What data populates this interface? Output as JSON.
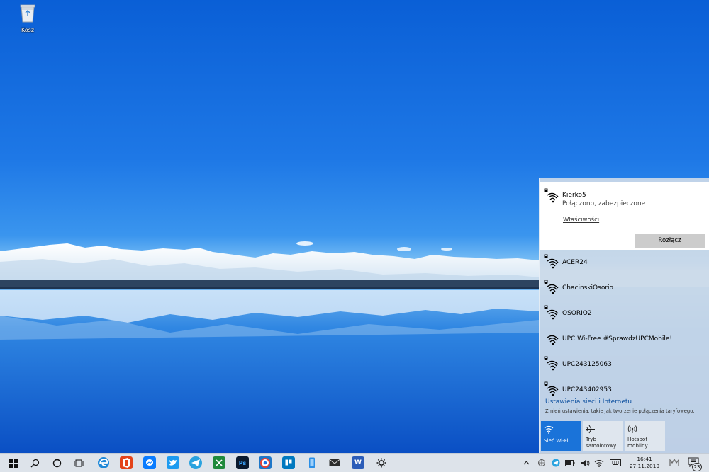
{
  "desktop": {
    "recycle_bin": {
      "label": "Kosz",
      "icon": "recycle-bin-icon"
    }
  },
  "flyout": {
    "connected": {
      "ssid": "Kierko5",
      "status": "Połączono, zabezpieczone",
      "properties_link": "Właściwości",
      "disconnect_button": "Rozłącz"
    },
    "networks": [
      {
        "ssid": "ACER24"
      },
      {
        "ssid": "ChacinskiOsorio"
      },
      {
        "ssid": "OSORIO2"
      },
      {
        "ssid": "UPC Wi-Free #SprawdzUPCMobile!"
      },
      {
        "ssid": "UPC243125063"
      },
      {
        "ssid": "UPC243402953"
      }
    ],
    "settings_link": "Ustawienia sieci i Internetu",
    "settings_description": "Zmień ustawienia, takie jak tworzenie połączenia taryfowego.",
    "quick_actions": {
      "wifi": {
        "label": "Sieć Wi-Fi",
        "active": true
      },
      "airplane": {
        "label_line1": "Tryb",
        "label_line2": "samolotowy",
        "active": false
      },
      "hotspot": {
        "label_line1": "Hotspot",
        "label_line2": "mobilny",
        "active": false
      }
    }
  },
  "taskbar": {
    "pinned": [
      "microsoft-edge-icon",
      "office-icon",
      "messenger-icon",
      "twitter-icon",
      "telegram-icon",
      "spreadsheet-app-icon",
      "photoshop-icon",
      "chrome-icon",
      "trello-icon",
      "phone-app-icon",
      "mail-icon",
      "word-icon",
      "settings-icon"
    ],
    "app_letters": {
      "photoshop": "Ps",
      "word": "W"
    },
    "clock": {
      "time": "16:41",
      "date": "27.11.2019"
    },
    "notifications": {
      "count": "23"
    }
  },
  "colors": {
    "accent": "#1a73d9",
    "link": "#0b4f9e",
    "flyout_bg": "#cddae8"
  }
}
